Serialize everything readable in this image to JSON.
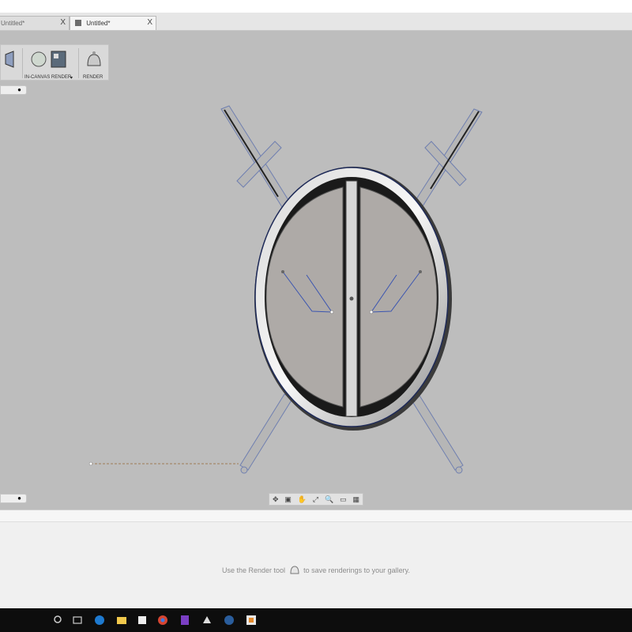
{
  "tabs": [
    {
      "label": "Untitled*",
      "close": "X",
      "active": false
    },
    {
      "label": "Untitled*",
      "close": "X",
      "active": true
    }
  ],
  "toolbar": {
    "in_canvas_label": "IN-CANVAS RENDER",
    "dropdown_glyph": "▾",
    "render_label": "RENDER"
  },
  "nav_pill_glyph": "●",
  "bottom_toolbar_glyphs": [
    "✥",
    "▣",
    "✋",
    "⤢",
    "🔍",
    "▭",
    "▦"
  ],
  "gallery": {
    "hint_before": "Use the Render tool",
    "hint_after": "to save renderings to your gallery."
  },
  "taskbar": {
    "apps": [
      "search-icon",
      "task-view-icon",
      "edge-icon",
      "file-explorer-icon",
      "store-icon",
      "chrome-icon",
      "visual-studio-icon",
      "inkscape-icon",
      "steam-icon",
      "fusion-icon"
    ]
  }
}
